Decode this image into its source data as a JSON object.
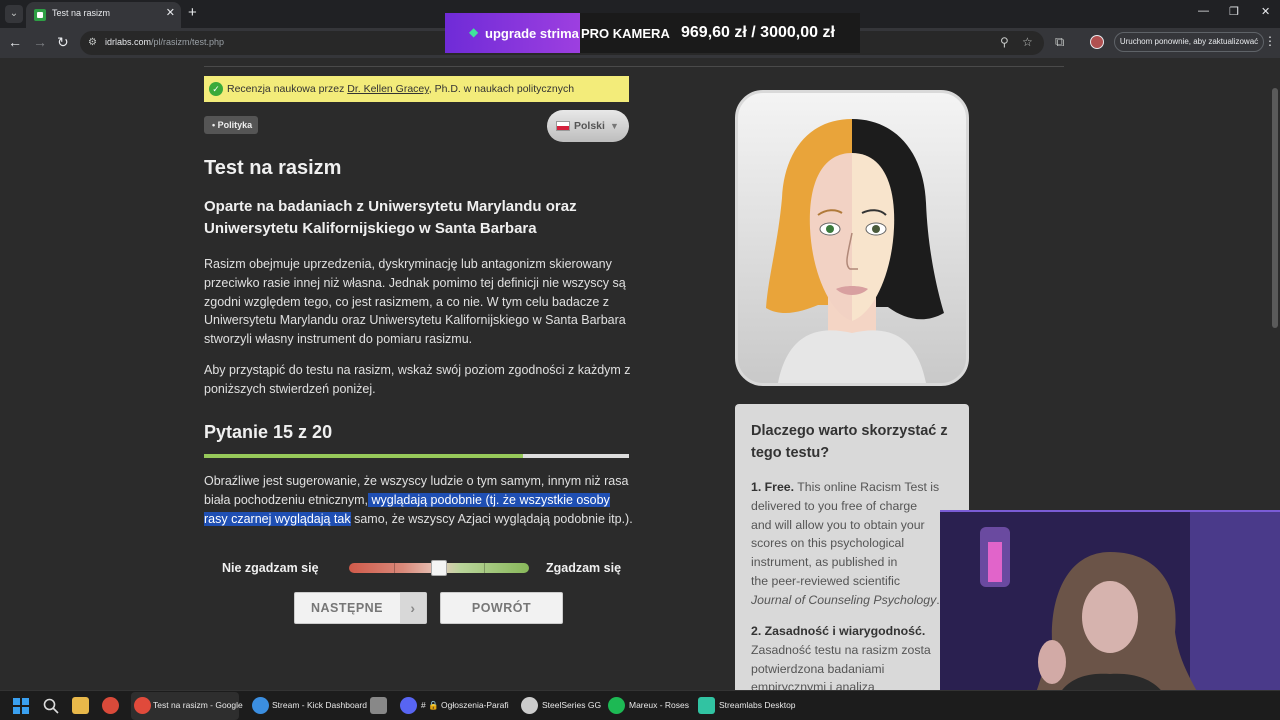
{
  "browser": {
    "tab_title": "Test na rasizm",
    "url_host": "idrlabs.com",
    "url_path": "/pl/rasizm/test.php",
    "update_label": "Uruchom ponownie, aby zaktualizować",
    "icons": {
      "tab_list": "chevron-down-icon",
      "close": "close-icon",
      "new_tab": "plus-icon",
      "back": "arrow-left-icon",
      "forward": "arrow-right-icon",
      "reload": "reload-icon",
      "site_info": "site-info-icon",
      "zoom": "zoom-icon",
      "bookmark": "star-icon",
      "extensions": "extensions-icon",
      "profile": "avatar",
      "menu": "kebab-icon"
    },
    "glyphs": {
      "chevron_down": "⌄",
      "close": "✕",
      "plus": "+",
      "minimize": "—",
      "restore": "❐",
      "back": "←",
      "forward": "→",
      "reload": "↻",
      "site_info": "⚙",
      "zoom": "⚲",
      "star": "☆",
      "extensions": "⧉",
      "menu": "⋮"
    }
  },
  "stream_overlay": {
    "diamond_glyph": "◆",
    "label": "upgrade strima",
    "item": "PRO KAMERA",
    "progress": "969,60 zł  /  3000,00 zł",
    "current": 969.6,
    "goal": 3000
  },
  "page": {
    "review": {
      "check": "✓",
      "prefix": "Recenzja naukowa przez ",
      "reviewer": "Dr. Kellen Gracey",
      "suffix": ", Ph.D. w naukach politycznych"
    },
    "tag": "• Polityka",
    "language": {
      "label": "Polski",
      "caret": "▼"
    },
    "title": "Test na rasizm",
    "subtitle": "Oparte na badaniach z Uniwersytetu Marylandu oraz Uniwersytetu Kalifornijskiego w Santa Barbara",
    "intro_1": "Rasizm obejmuje uprzedzenia, dyskryminację lub antagonizm skierowany przeciwko rasie innej niż własna. Jednak pomimo tej definicji nie wszyscy są zgodni względem tego, co jest rasizmem, a co nie. W tym celu badacze z Uniwersytetu Marylandu oraz Uniwersytetu Kalifornijskiego w Santa Barbara stworzyli własny instrument do pomiaru rasizmu.",
    "intro_2": "Aby przystąpić do testu na rasizm, wskaż swój poziom zgodności z każdym z poniższych stwierdzeń poniżej.",
    "question": {
      "title": "Pytanie 15 z 20",
      "number": 15,
      "total": 20,
      "text_before": "Obraźliwe jest sugerowanie, że wszyscy ludzie o tym samym, innym niż rasa biała pochodzeniu etnicznym,",
      "text_highlight": " wyglądają podobnie (tj. że wszystkie osoby rasy czarnej wyglądają tak",
      "text_after": " samo, że wszyscy Azjaci wyglądają podobnie itp.).",
      "disagree": "Nie zgadzam się",
      "agree": "Zgadzam się",
      "slider_value": 0.5,
      "next": "NASTĘPNE",
      "next_arrow": "›",
      "back": "POWRÓT"
    },
    "sidebox": {
      "title": "Dlaczego warto skorzystać z tego testu?",
      "p1_label": "1. Free.",
      "p1_lines": [
        " This online Racism Test is",
        "delivered to you free of charge",
        "and will allow you to obtain your",
        "scores on this psychological",
        "instrument, as published in",
        "the peer-reviewed scientific"
      ],
      "p1_journal": "Journal of Counseling Psychology",
      "p1_end": ".",
      "p2_label": "2. Zasadność i wiarygodność.",
      "p2_lines": [
        "Zasadność testu na rasizm zosta",
        "potwierdzona badaniami",
        "empirycznymi i analiza"
      ]
    }
  },
  "taskbar": {
    "items": [
      {
        "label": "Test na rasizm - Google",
        "color": "#e04a3b"
      },
      {
        "label": "Stream - Kick Dashboard",
        "color": "#3b8ee0"
      },
      {
        "label": "# 🔒 Ogłoszenia-Parafia...",
        "color": "#5865f2"
      },
      {
        "label": "SteelSeries GG",
        "color": "#cccccc"
      },
      {
        "label": "Mareux - Roses",
        "color": "#1db954"
      },
      {
        "label": "Streamlabs Desktop",
        "color": "#31c3a2"
      }
    ]
  }
}
